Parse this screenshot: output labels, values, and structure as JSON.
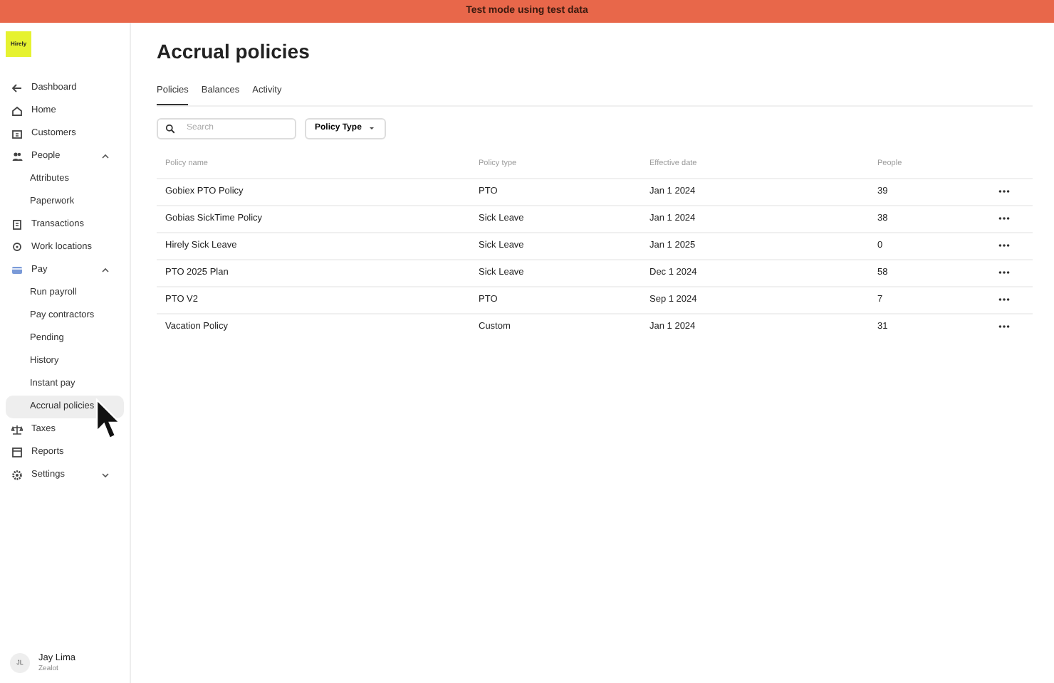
{
  "banner": {
    "text": "Test mode using test data"
  },
  "logo": {
    "text": "Hirely"
  },
  "sidebar": {
    "items": [
      {
        "label": "Dashboard",
        "selected": false
      },
      {
        "label": "Home",
        "selected": false
      },
      {
        "label": "Customers",
        "selected": false
      },
      {
        "label": "People",
        "selected": false,
        "expanded": true,
        "children": [
          {
            "label": "Attributes",
            "selected": false
          },
          {
            "label": "Paperwork",
            "selected": false
          }
        ]
      },
      {
        "label": "Transactions",
        "selected": false
      },
      {
        "label": "Work locations",
        "selected": false
      },
      {
        "label": "Pay",
        "selected": false,
        "expanded": true,
        "children": [
          {
            "label": "Run payroll",
            "selected": false
          },
          {
            "label": "Pay contractors",
            "selected": false
          },
          {
            "label": "Pending",
            "selected": false
          },
          {
            "label": "History",
            "selected": false
          },
          {
            "label": "Instant pay",
            "selected": false
          },
          {
            "label": "Accrual policies",
            "selected": true
          }
        ]
      },
      {
        "label": "Taxes",
        "selected": false
      },
      {
        "label": "Reports",
        "selected": false
      },
      {
        "label": "Settings",
        "selected": false,
        "expanded": false
      }
    ]
  },
  "user": {
    "initials": "JL",
    "name": "Jay Lima",
    "company": "Zealot"
  },
  "page": {
    "title": "Accrual policies"
  },
  "tabs": [
    {
      "label": "Policies",
      "selected": true
    },
    {
      "label": "Balances",
      "selected": false
    },
    {
      "label": "Activity",
      "selected": false
    }
  ],
  "search": {
    "placeholder": "Search"
  },
  "filter": {
    "label": "Policy Type"
  },
  "table": {
    "columns": [
      "Policy name",
      "Policy type",
      "Effective date",
      "People"
    ],
    "rows": [
      [
        "Gobiex PTO Policy",
        "PTO",
        "Jan 1 2024",
        "39"
      ],
      [
        "Gobias SickTime Policy",
        "Sick Leave",
        "Jan 1 2024",
        "38"
      ],
      [
        "Hirely Sick Leave",
        "Sick Leave",
        "Jan 1 2025",
        "0"
      ],
      [
        "PTO 2025 Plan",
        "Sick Leave",
        "Dec 1 2024",
        "58"
      ],
      [
        "PTO V2",
        "PTO",
        "Sep 1 2024",
        "7"
      ],
      [
        "Vacation Policy",
        "Custom",
        "Jan 1 2024",
        "31"
      ]
    ]
  }
}
